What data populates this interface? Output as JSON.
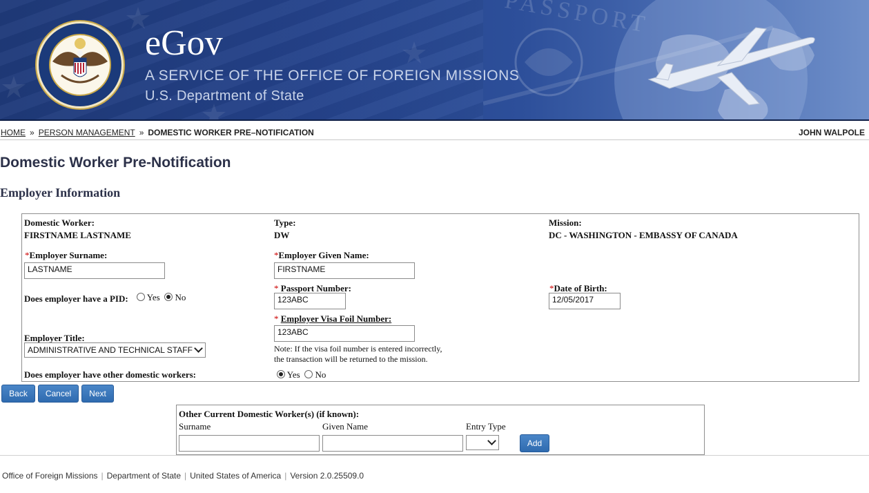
{
  "banner": {
    "brand": "eGov",
    "subtitle_line1": "A SERVICE OF THE OFFICE OF FOREIGN MISSIONS",
    "subtitle_line2": "U.S. Department of State",
    "seal_text": "DEPARTMENT OF STATE · UNITED STATES OF AMERICA",
    "passport_text": "PASSPORT",
    "colors": {
      "banner": "#24428a",
      "text_light": "#c9d4ea"
    }
  },
  "breadcrumb": {
    "home": "HOME",
    "person_management": "PERSON MANAGEMENT",
    "separator": "»",
    "current": "DOMESTIC WORKER PRE–NOTIFICATION",
    "user": "JOHN WALPOLE"
  },
  "page": {
    "title": "Domestic Worker Pre-Notification",
    "section": "Employer Information"
  },
  "form": {
    "domestic_worker_label": "Domestic Worker:",
    "domestic_worker_value": "FIRSTNAME LASTNAME",
    "type_label": "Type:",
    "type_value": "DW",
    "mission_label": "Mission:",
    "mission_value": "DC - WASHINGTON - EMBASSY OF CANADA",
    "required_mark": "*",
    "employer_surname_label": "Employer Surname:",
    "employer_surname_value": "LASTNAME",
    "employer_given_name_label": "Employer Given Name:",
    "employer_given_name_value": "FIRSTNAME",
    "pid_question": "Does employer have a PID:",
    "pid_yes": "Yes",
    "pid_no": "No",
    "pid_selected": "No",
    "passport_label": " Passport Number:",
    "passport_value": "123ABC",
    "dob_label": "Date of Birth:",
    "dob_value": "12/05/2017",
    "visa_foil_label": "Employer Visa Foil Number:",
    "visa_foil_value": "123ABC",
    "visa_note_line1": "Note: If the visa foil number is entered incorrectly,",
    "visa_note_line2": "the transaction will be returned to the mission.",
    "employer_title_label": "Employer Title:",
    "employer_title_value": "ADMINISTRATIVE AND TECHNICAL STAFF",
    "other_workers_question": "Does employer have other domestic workers:",
    "other_yes": "Yes",
    "other_no": "No",
    "other_selected": "Yes"
  },
  "buttons": {
    "back": "Back",
    "cancel": "Cancel",
    "next": "Next",
    "add": "Add",
    "color": "#2f6bb0"
  },
  "other_workers": {
    "title": "Other Current Domestic Worker(s) (if known):",
    "col_surname": "Surname",
    "col_given_name": "Given Name",
    "col_entry_type": "Entry Type",
    "surname_value": "",
    "given_name_value": "",
    "entry_type_value": ""
  },
  "footer": {
    "items": [
      "Office of Foreign Missions",
      "Department of State",
      "United States of America",
      "Version 2.0.25509.0"
    ]
  }
}
